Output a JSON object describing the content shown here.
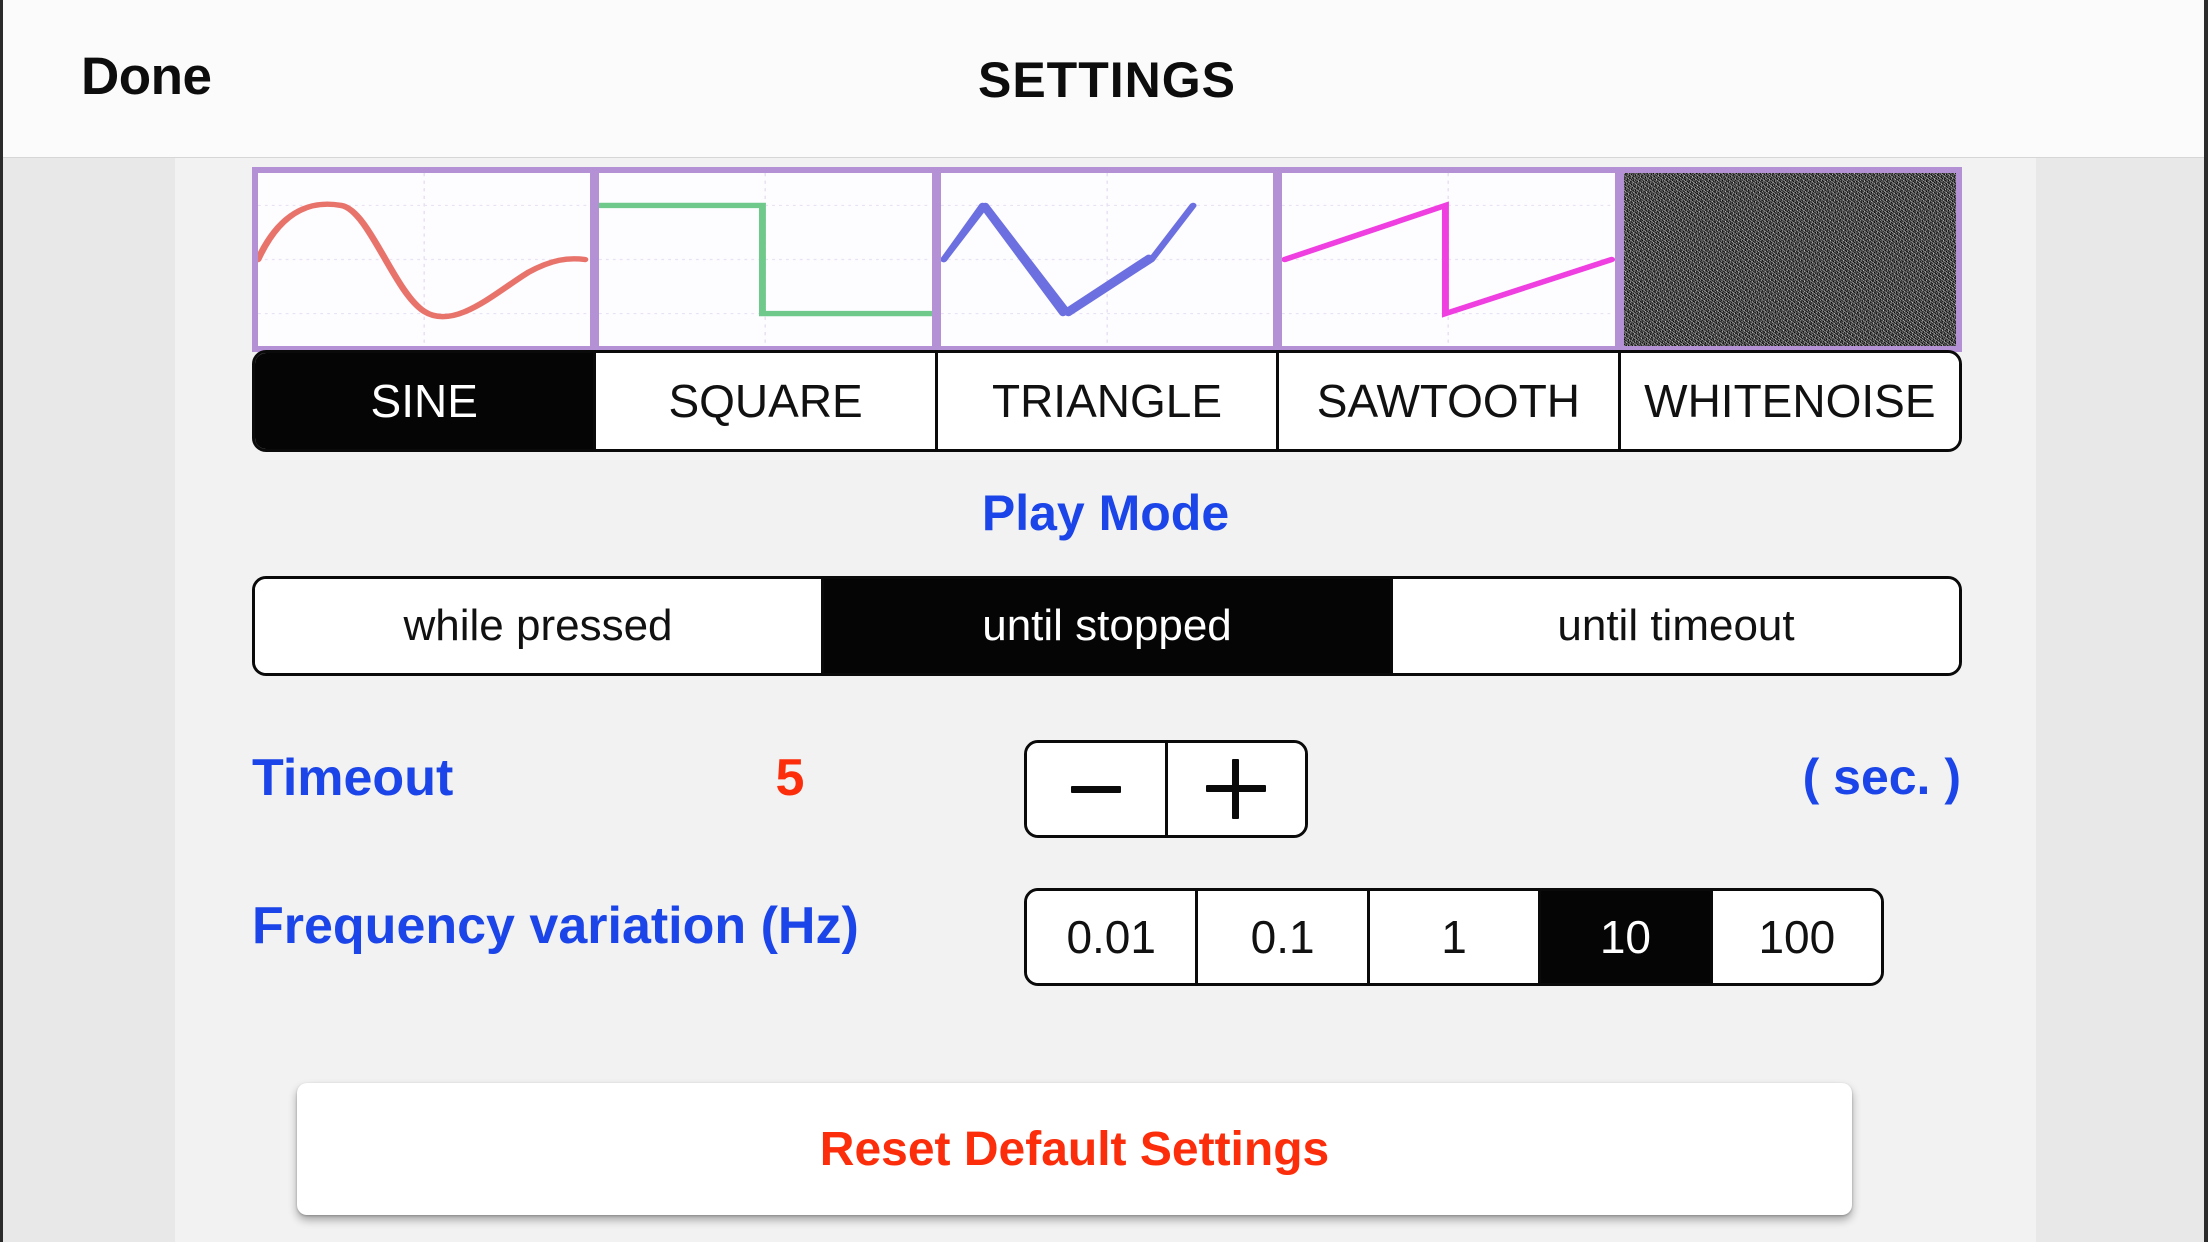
{
  "navbar": {
    "done_label": "Done",
    "title": "SETTINGS"
  },
  "waveform_section": {
    "thumbnails": [
      {
        "name": "sine",
        "color": "#e8736b"
      },
      {
        "name": "square",
        "color": "#6fc98a"
      },
      {
        "name": "triangle",
        "color": "#6c6fe0"
      },
      {
        "name": "sawtooth",
        "color": "#ef3fe0"
      },
      {
        "name": "whitenoise",
        "color": "#4a4a4a"
      }
    ],
    "options": [
      {
        "label": "SINE",
        "selected": true
      },
      {
        "label": "SQUARE",
        "selected": false
      },
      {
        "label": "TRIANGLE",
        "selected": false
      },
      {
        "label": "SAWTOOTH",
        "selected": false
      },
      {
        "label": "WHITENOISE",
        "selected": false
      }
    ],
    "selected": "SINE",
    "frame_color": "#b491d4"
  },
  "play_mode": {
    "heading": "Play Mode",
    "heading_color": "#1b45e8",
    "options": [
      {
        "label": "while pressed",
        "selected": false
      },
      {
        "label": "until stopped",
        "selected": true
      },
      {
        "label": "until timeout",
        "selected": false
      }
    ],
    "selected": "until stopped"
  },
  "timeout": {
    "label": "Timeout",
    "label_color": "#1b45e8",
    "value": "5",
    "value_color": "#fc2d0b",
    "unit_label": "( sec. )",
    "decrement_icon": "minus-icon",
    "increment_icon": "plus-icon"
  },
  "frequency_variation": {
    "label": "Frequency variation (Hz)",
    "label_color": "#1b45e8",
    "options": [
      {
        "label": "0.01",
        "selected": false
      },
      {
        "label": "0.1",
        "selected": false
      },
      {
        "label": "1",
        "selected": false
      },
      {
        "label": "10",
        "selected": true
      },
      {
        "label": "100",
        "selected": false
      }
    ],
    "selected": "10"
  },
  "reset": {
    "label": "Reset Default Settings",
    "label_color": "#fb2d0b"
  }
}
